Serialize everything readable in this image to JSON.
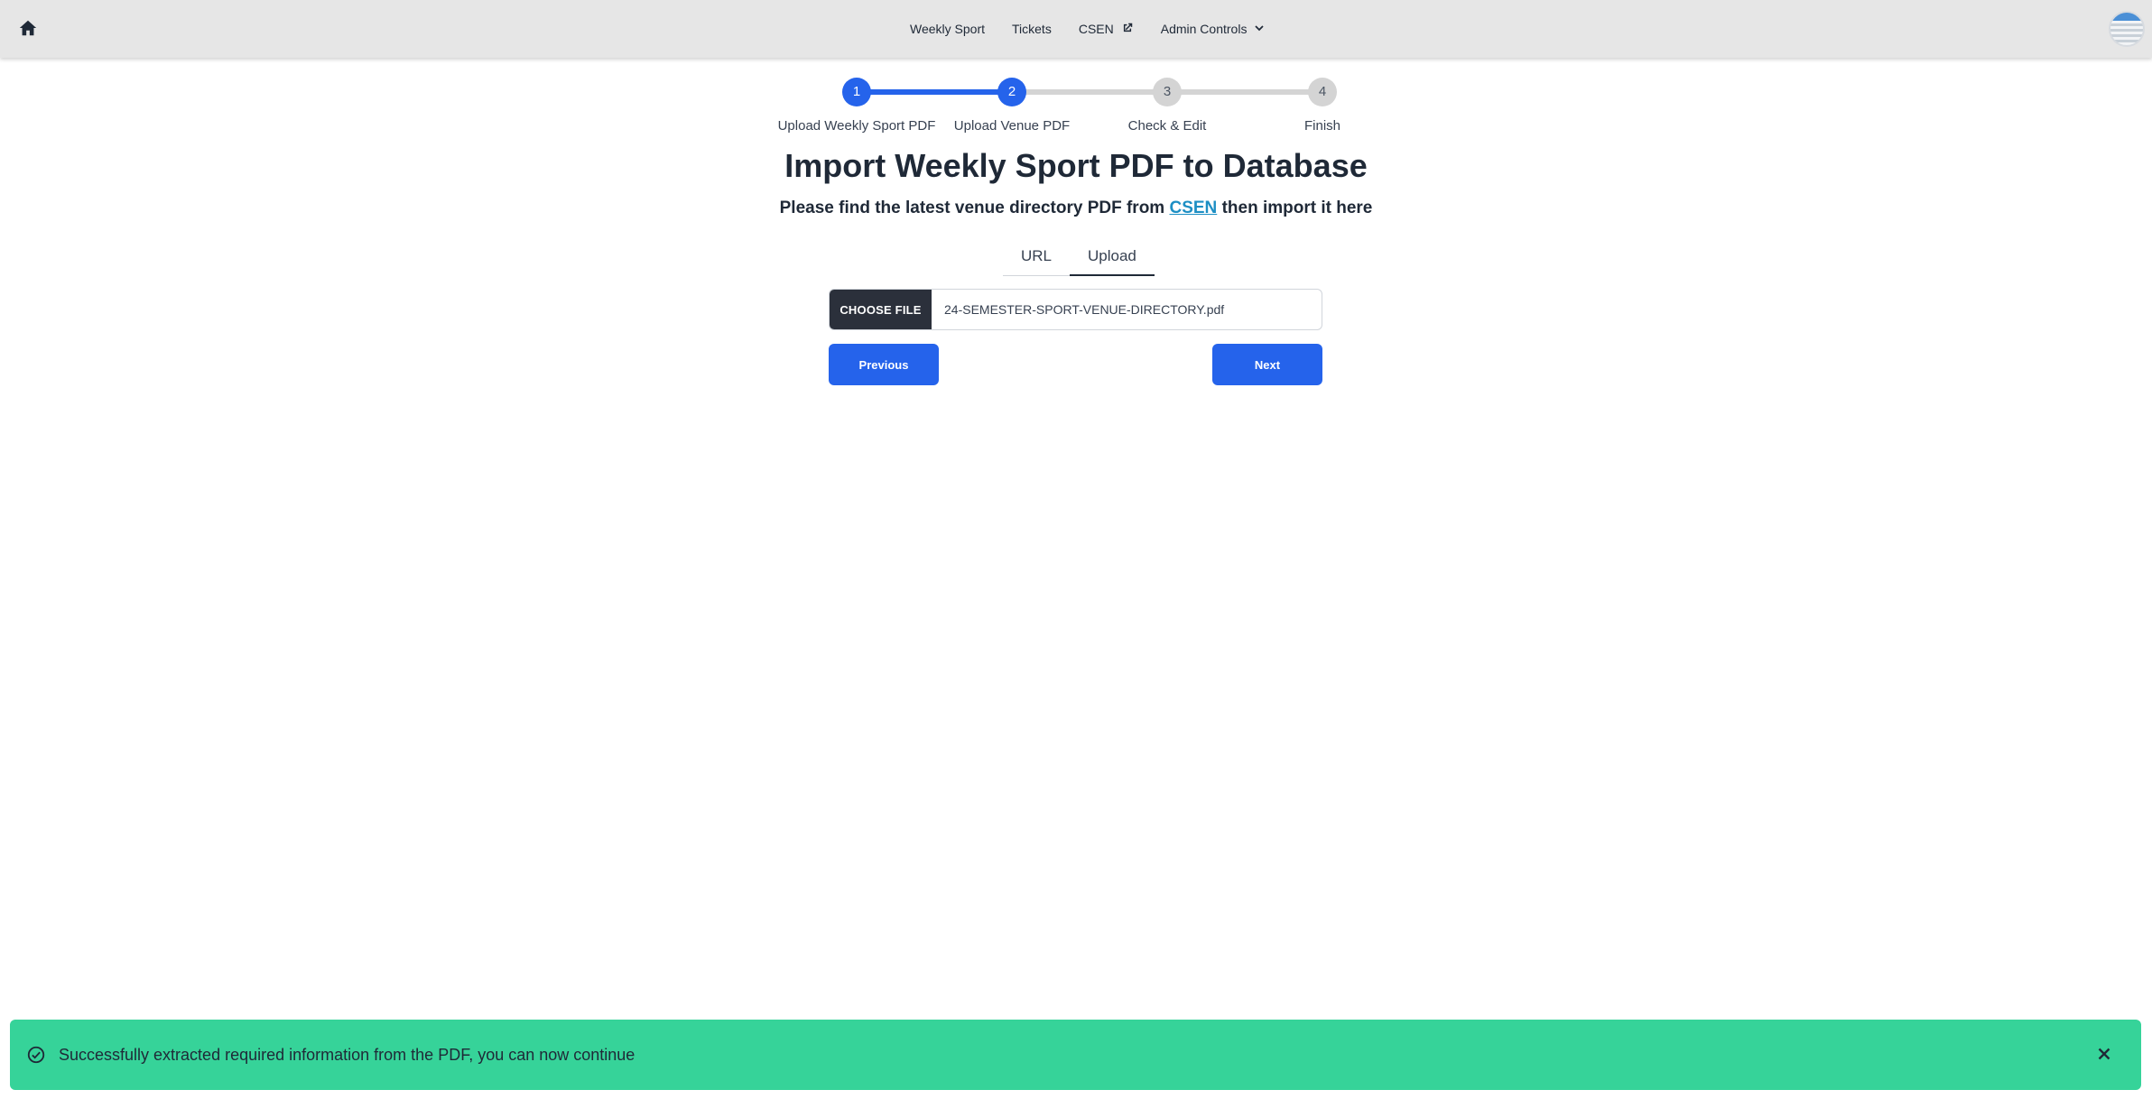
{
  "nav": {
    "links": [
      {
        "label": "Weekly Sport"
      },
      {
        "label": "Tickets"
      },
      {
        "label": "CSEN"
      },
      {
        "label": "Admin Controls"
      }
    ],
    "icons": {
      "home": "home-icon",
      "external": "external-link-icon",
      "dropdown": "chevron-down-icon"
    }
  },
  "stepper": {
    "steps": [
      {
        "number": "1",
        "label": "Upload Weekly Sport PDF",
        "state": "complete"
      },
      {
        "number": "2",
        "label": "Upload Venue PDF",
        "state": "current"
      },
      {
        "number": "3",
        "label": "Check & Edit",
        "state": "pending"
      },
      {
        "number": "4",
        "label": "Finish",
        "state": "pending"
      }
    ],
    "colors": {
      "active": "#2563eb",
      "inactive": "#d4d4d4"
    }
  },
  "main": {
    "title": "Import Weekly Sport PDF to Database",
    "subtitle_before": "Please find the latest venue directory PDF from",
    "subtitle_link": "CSEN",
    "subtitle_after": "then import it here",
    "tabs": [
      {
        "label": "URL",
        "active": false
      },
      {
        "label": "Upload",
        "active": true
      }
    ],
    "file": {
      "button_label": "CHOOSE FILE",
      "file_name": "24-SEMESTER-SPORT-VENUE-DIRECTORY.pdf"
    },
    "previous_label": "Previous",
    "next_label": "Next"
  },
  "toast": {
    "message": "Successfully extracted required information from the PDF, you can now continue",
    "color": "#36d399"
  }
}
